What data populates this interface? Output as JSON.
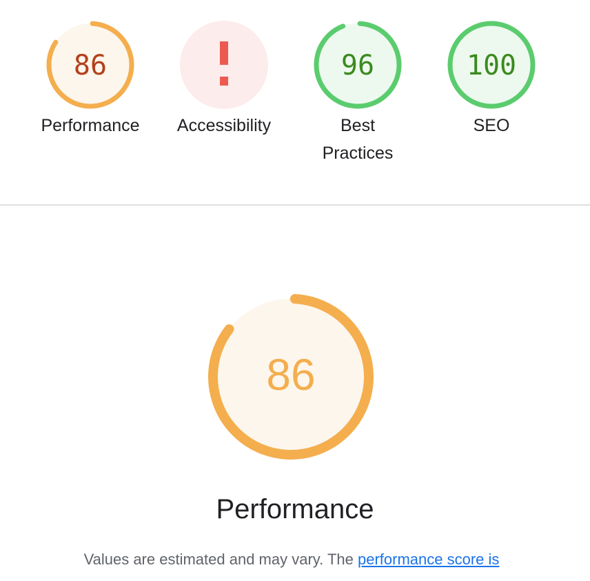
{
  "colors": {
    "average": "#f4ae4e",
    "average_bg": "#fdf6ec",
    "average_text": "#b4401b",
    "pass": "#5bcc6e",
    "pass_bg": "#edf9ef",
    "pass_text": "#3b8a1e",
    "fail": "#ec5a4f",
    "fail_bg": "#fdecec"
  },
  "categories": [
    {
      "label": "Performance",
      "score": "86",
      "value": 86,
      "status": "average"
    },
    {
      "label": "Accessibility",
      "score": "!",
      "status": "error",
      "icon": "exclamation-icon"
    },
    {
      "label": "Best Practices",
      "score": "96",
      "value": 96,
      "status": "pass"
    },
    {
      "label": "SEO",
      "score": "100",
      "value": 100,
      "status": "pass"
    }
  ],
  "main": {
    "score": "86",
    "value": 86,
    "title": "Performance",
    "note": "Values are estimated and may vary. The ",
    "note_link": "performance score is"
  }
}
